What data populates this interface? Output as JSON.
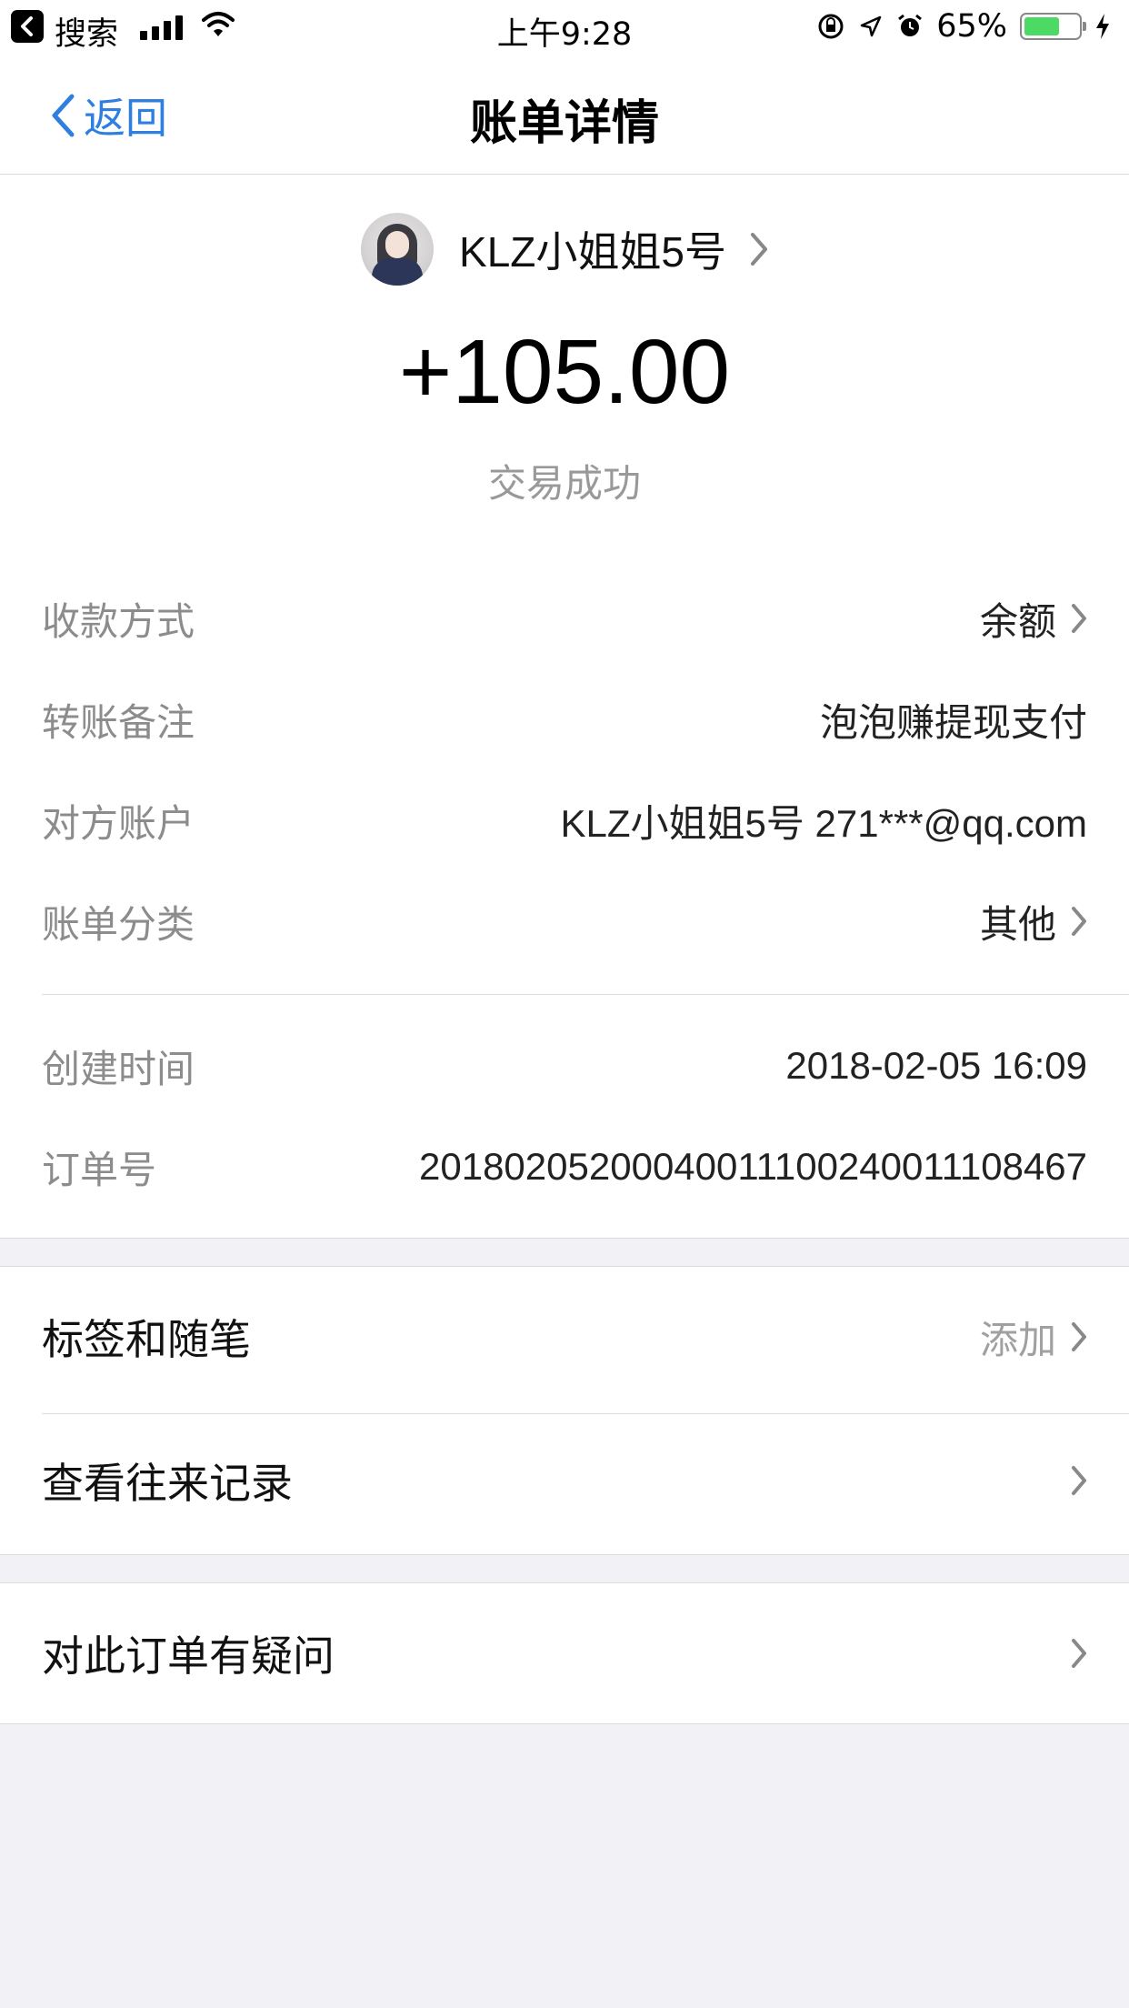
{
  "status_bar": {
    "back_app_label": "搜索",
    "time": "上午9:28",
    "battery": "65%",
    "battery_level": 0.65,
    "battery_color": "#4cd964"
  },
  "nav": {
    "back_label": "返回",
    "title": "账单详情",
    "accent": "#2f7fe0"
  },
  "payer": {
    "name": "KLZ小姐姐5号",
    "avatar_icon": "avatar-icon"
  },
  "transaction": {
    "amount": "+105.00",
    "status": "交易成功"
  },
  "details": [
    {
      "label": "收款方式",
      "value": "余额",
      "chevron": true
    },
    {
      "label": "转账备注",
      "value": "泡泡赚提现支付",
      "chevron": false
    },
    {
      "label": "对方账户",
      "value": "KLZ小姐姐5号 271***@qq.com",
      "chevron": false
    },
    {
      "label": "账单分类",
      "value": "其他",
      "chevron": true
    }
  ],
  "meta": [
    {
      "label": "创建时间",
      "value": "2018-02-05 16:09"
    },
    {
      "label": "订单号",
      "value": "20180205200040011100240011108467"
    }
  ],
  "actions": {
    "tags_label": "标签和随笔",
    "tags_action": "添加",
    "history_label": "查看往来记录",
    "question_label": "对此订单有疑问"
  }
}
